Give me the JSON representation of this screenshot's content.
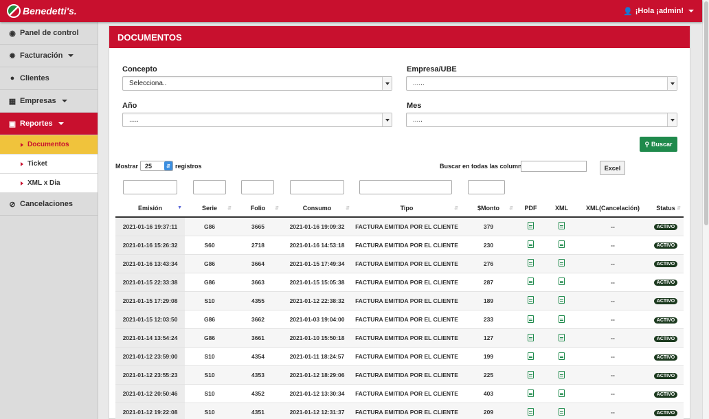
{
  "topbar": {
    "brand": "Benedetti's.",
    "user": "¡Hola ¡admin!"
  },
  "sidebar": {
    "items": [
      {
        "label": "Panel de control",
        "icon": "dashboard-icon"
      },
      {
        "label": "Facturación",
        "icon": "gear-icon"
      },
      {
        "label": "Clientes",
        "icon": "users-icon"
      },
      {
        "label": "Empresas",
        "icon": "building-icon"
      },
      {
        "label": "Reportes",
        "icon": "file-pdf-icon"
      },
      {
        "label": "Cancelaciones",
        "icon": "ban-icon"
      }
    ],
    "subitems": [
      "Documentos",
      "Ticket",
      "XML x Dia"
    ]
  },
  "panel": {
    "title": "DOCUMENTOS"
  },
  "filters": {
    "concepto_label": "Concepto",
    "concepto_value": "Selecciona..",
    "empresa_label": "Empresa/UBE",
    "empresa_value": "......",
    "anio_label": "Año",
    "anio_value": ".....",
    "mes_label": "Mes",
    "mes_value": ".....",
    "buscar_label": "Buscar"
  },
  "table_controls": {
    "mostrar": "Mostrar",
    "length": "25",
    "registros": "registros",
    "search_label": "Buscar en todas las columnas:",
    "excel": "Excel"
  },
  "table": {
    "headers": [
      "Emisión",
      "Serie",
      "Folio",
      "Consumo",
      "Tipo",
      "$Monto",
      "PDF",
      "XML",
      "XML(Cancelación)",
      "Status"
    ],
    "rows": [
      [
        "2021-01-16 19:37:11",
        "G86",
        "3665",
        "2021-01-16 19:09:32",
        "FACTURA EMITIDA POR EL CLIENTE",
        "379",
        "--",
        "ACTIVO"
      ],
      [
        "2021-01-16 15:26:32",
        "S60",
        "2718",
        "2021-01-16 14:53:18",
        "FACTURA EMITIDA POR EL CLIENTE",
        "230",
        "--",
        "ACTIVO"
      ],
      [
        "2021-01-16 13:43:34",
        "G86",
        "3664",
        "2021-01-15 17:49:34",
        "FACTURA EMITIDA POR EL CLIENTE",
        "276",
        "--",
        "ACTIVO"
      ],
      [
        "2021-01-15 22:33:38",
        "G86",
        "3663",
        "2021-01-15 15:05:38",
        "FACTURA EMITIDA POR EL CLIENTE",
        "287",
        "--",
        "ACTIVO"
      ],
      [
        "2021-01-15 17:29:08",
        "S10",
        "4355",
        "2021-01-12 22:38:32",
        "FACTURA EMITIDA POR EL CLIENTE",
        "189",
        "--",
        "ACTIVO"
      ],
      [
        "2021-01-15 12:03:50",
        "G86",
        "3662",
        "2021-01-03 19:04:00",
        "FACTURA EMITIDA POR EL CLIENTE",
        "233",
        "--",
        "ACTIVO"
      ],
      [
        "2021-01-14 13:54:24",
        "G86",
        "3661",
        "2021-01-10 15:50:18",
        "FACTURA EMITIDA POR EL CLIENTE",
        "127",
        "--",
        "ACTIVO"
      ],
      [
        "2021-01-12 23:59:00",
        "S10",
        "4354",
        "2021-01-11 18:24:57",
        "FACTURA EMITIDA POR EL CLIENTE",
        "199",
        "--",
        "ACTIVO"
      ],
      [
        "2021-01-12 23:55:23",
        "S10",
        "4353",
        "2021-01-12 18:29:06",
        "FACTURA EMITIDA POR EL CLIENTE",
        "225",
        "--",
        "ACTIVO"
      ],
      [
        "2021-01-12 20:50:46",
        "S10",
        "4352",
        "2021-01-12 13:30:34",
        "FACTURA EMITIDA POR EL CLIENTE",
        "403",
        "--",
        "ACTIVO"
      ],
      [
        "2021-01-12 19:22:08",
        "S10",
        "4351",
        "2021-01-12 12:31:37",
        "FACTURA EMITIDA POR EL CLIENTE",
        "209",
        "--",
        "ACTIVO"
      ]
    ]
  },
  "colors": {
    "brand_red": "#c8102e",
    "active_yellow": "#f0c33c",
    "action_green": "#1f8a4c"
  }
}
